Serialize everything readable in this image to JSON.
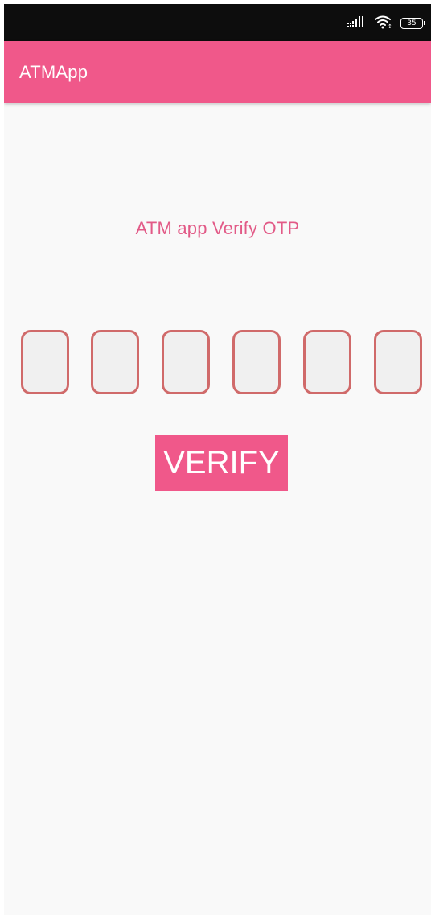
{
  "status_bar": {
    "icons": [
      "signal-icon",
      "wifi-icon",
      "battery-icon"
    ],
    "battery_level": "35"
  },
  "app_bar": {
    "title": "ATMApp"
  },
  "main": {
    "heading": "ATM app Verify OTP",
    "otp_fields": [
      {
        "value": ""
      },
      {
        "value": ""
      },
      {
        "value": ""
      },
      {
        "value": ""
      },
      {
        "value": ""
      },
      {
        "value": ""
      }
    ],
    "verify_button_label": "VERIFY"
  },
  "colors": {
    "accent": "#f0588a",
    "heading_text": "#e25a87",
    "otp_border": "#d06a6a",
    "status_bar": "#0d0d0d",
    "background": "#f9f9f9"
  }
}
